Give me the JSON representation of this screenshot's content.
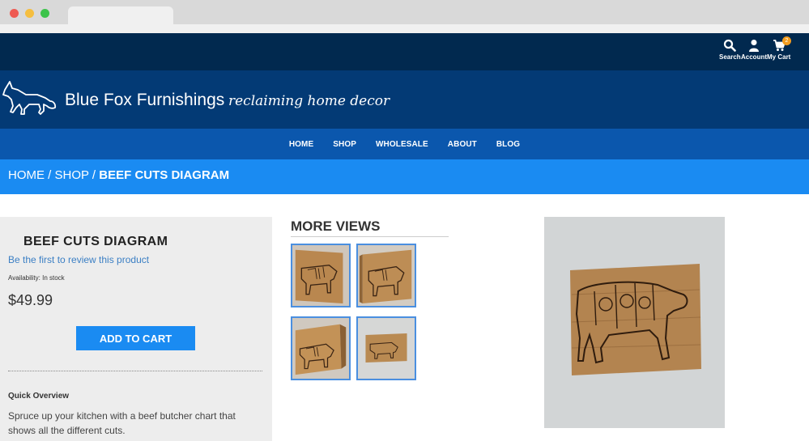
{
  "topbar": {
    "search_label": "Search",
    "account_label": "Account",
    "cart_label": "My Cart",
    "cart_count": "2"
  },
  "header": {
    "brand_name": "Blue Fox Furnishings",
    "tagline": "reclaiming home decor"
  },
  "nav": {
    "items": [
      "HOME",
      "SHOP",
      "WHOLESALE",
      "ABOUT",
      "BLOG"
    ]
  },
  "breadcrumb": {
    "home": "HOME",
    "shop": "SHOP",
    "separator": " / ",
    "current": "BEEF CUTS DIAGRAM"
  },
  "product": {
    "title": "BEEF CUTS DIAGRAM",
    "review_link": "Be the first to review this product",
    "availability": "Availability: In stock",
    "price": "$49.99",
    "add_to_cart": "ADD TO CART",
    "overview_title": "Quick Overview",
    "overview_text": "Spruce up your kitchen with a beef butcher chart that shows all the different cuts."
  },
  "more_views": {
    "title": "MORE VIEWS",
    "thumbnail_count": 4
  },
  "colors": {
    "topbar": "#01294f",
    "header": "#033a75",
    "nav": "#0b57ad",
    "breadcrumb": "#1a8bf2",
    "accent": "#1a8bf2",
    "cart_badge": "#f29c1f"
  },
  "icons": [
    "search-icon",
    "account-icon",
    "cart-icon",
    "fox-logo-icon"
  ]
}
